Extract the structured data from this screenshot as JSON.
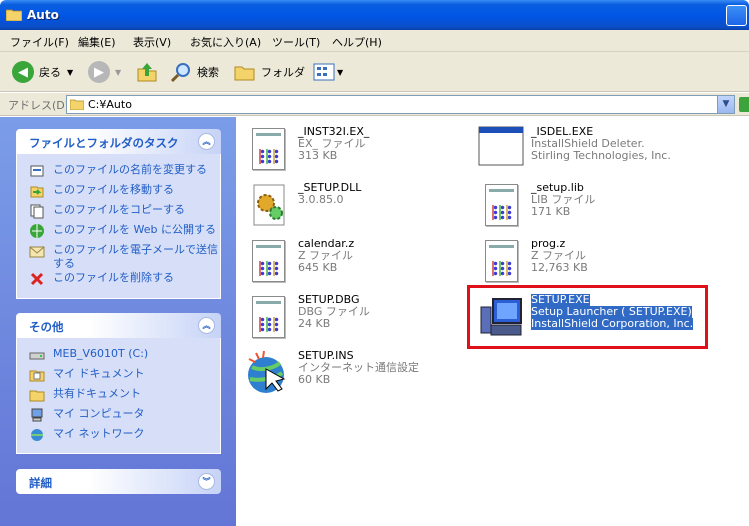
{
  "window": {
    "title": "Auto"
  },
  "menu": [
    "ファイル(F)",
    "編集(E)",
    "表示(V)",
    "お気に入り(A)",
    "ツール(T)",
    "ヘルプ(H)"
  ],
  "toolbar": {
    "back": "戻る",
    "search": "検索",
    "folders": "フォルダ"
  },
  "address": {
    "label": "アドレス(D)",
    "path": "C:¥Auto"
  },
  "tasks_panel": {
    "title": "ファイルとフォルダのタスク",
    "items": [
      "このファイルの名前を変更する",
      "このファイルを移動する",
      "このファイルをコピーする",
      "このファイルを Web に公開する",
      "このファイルを電子メールで送信する",
      "このファイルを削除する"
    ]
  },
  "other_panel": {
    "title": "その他",
    "items": [
      "MEB_V6010T (C:)",
      "マイ ドキュメント",
      "共有ドキュメント",
      "マイ コンピュータ",
      "マイ ネットワーク"
    ]
  },
  "details_panel": {
    "title": "詳細"
  },
  "files": [
    {
      "name": "_INST32I.EX_",
      "type": "EX_ ファイル",
      "size": "313 KB"
    },
    {
      "name": "_ISDEL.EXE",
      "type": "InstallShield Deleter.",
      "size": "Stirling Technologies, Inc."
    },
    {
      "name": "_SETUP.DLL",
      "type": "3.0.85.0",
      "size": ""
    },
    {
      "name": "_setup.lib",
      "type": "LIB ファイル",
      "size": "171 KB"
    },
    {
      "name": "calendar.z",
      "type": "Z ファイル",
      "size": "645 KB"
    },
    {
      "name": "prog.z",
      "type": "Z ファイル",
      "size": "12,763 KB"
    },
    {
      "name": "SETUP.DBG",
      "type": "DBG ファイル",
      "size": "24 KB"
    },
    {
      "name": "SETUP.EXE",
      "type": "Setup Launcher ( SETUP.EXE)",
      "size": "InstallShield Corporation, Inc."
    },
    {
      "name": "SETUP.INS",
      "type": "インターネット通信設定",
      "size": "60 KB"
    }
  ],
  "colors": {
    "title_bar": "#0055e5",
    "selection": "#316ac5",
    "highlight_box": "#e0101a",
    "pane": "#6f8be0"
  }
}
